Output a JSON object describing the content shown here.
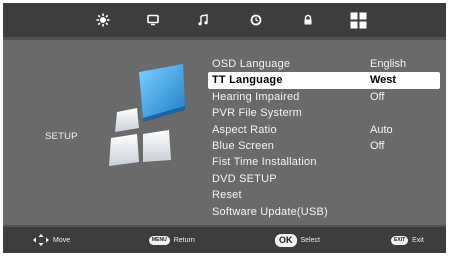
{
  "top_tabs": [
    {
      "icon": "picture-icon"
    },
    {
      "icon": "tv-icon"
    },
    {
      "icon": "music-icon"
    },
    {
      "icon": "clock-icon"
    },
    {
      "icon": "lock-icon"
    },
    {
      "icon": "setup-grid-icon",
      "active": true
    }
  ],
  "panel": {
    "title": "SETUP"
  },
  "menu": [
    {
      "label": "OSD Language",
      "value": "English"
    },
    {
      "label": "TT Language",
      "value": "West",
      "selected": true
    },
    {
      "label": "Hearing Impaired",
      "value": "Off"
    },
    {
      "label": "PVR File Systerm",
      "value": ""
    },
    {
      "label": "Aspect Ratio",
      "value": "Auto"
    },
    {
      "label": "Blue Screen",
      "value": "Off"
    },
    {
      "label": "Fist Time Installation",
      "value": ""
    },
    {
      "label": "DVD SETUP",
      "value": ""
    },
    {
      "label": "Reset",
      "value": ""
    },
    {
      "label": "Software Update(USB)",
      "value": ""
    }
  ],
  "bottom": {
    "move": {
      "label": "Move"
    },
    "return": {
      "key": "MENU",
      "label": "Return"
    },
    "select": {
      "key": "OK",
      "label": "Select"
    },
    "exit": {
      "key": "EXIT",
      "label": "Exit"
    }
  },
  "colors": {
    "background": "#525252",
    "panel": "#6a6a6a",
    "bars": "#3d3d3d",
    "highlight": "#ffffff",
    "accent_blue": "#3a9fe0"
  }
}
